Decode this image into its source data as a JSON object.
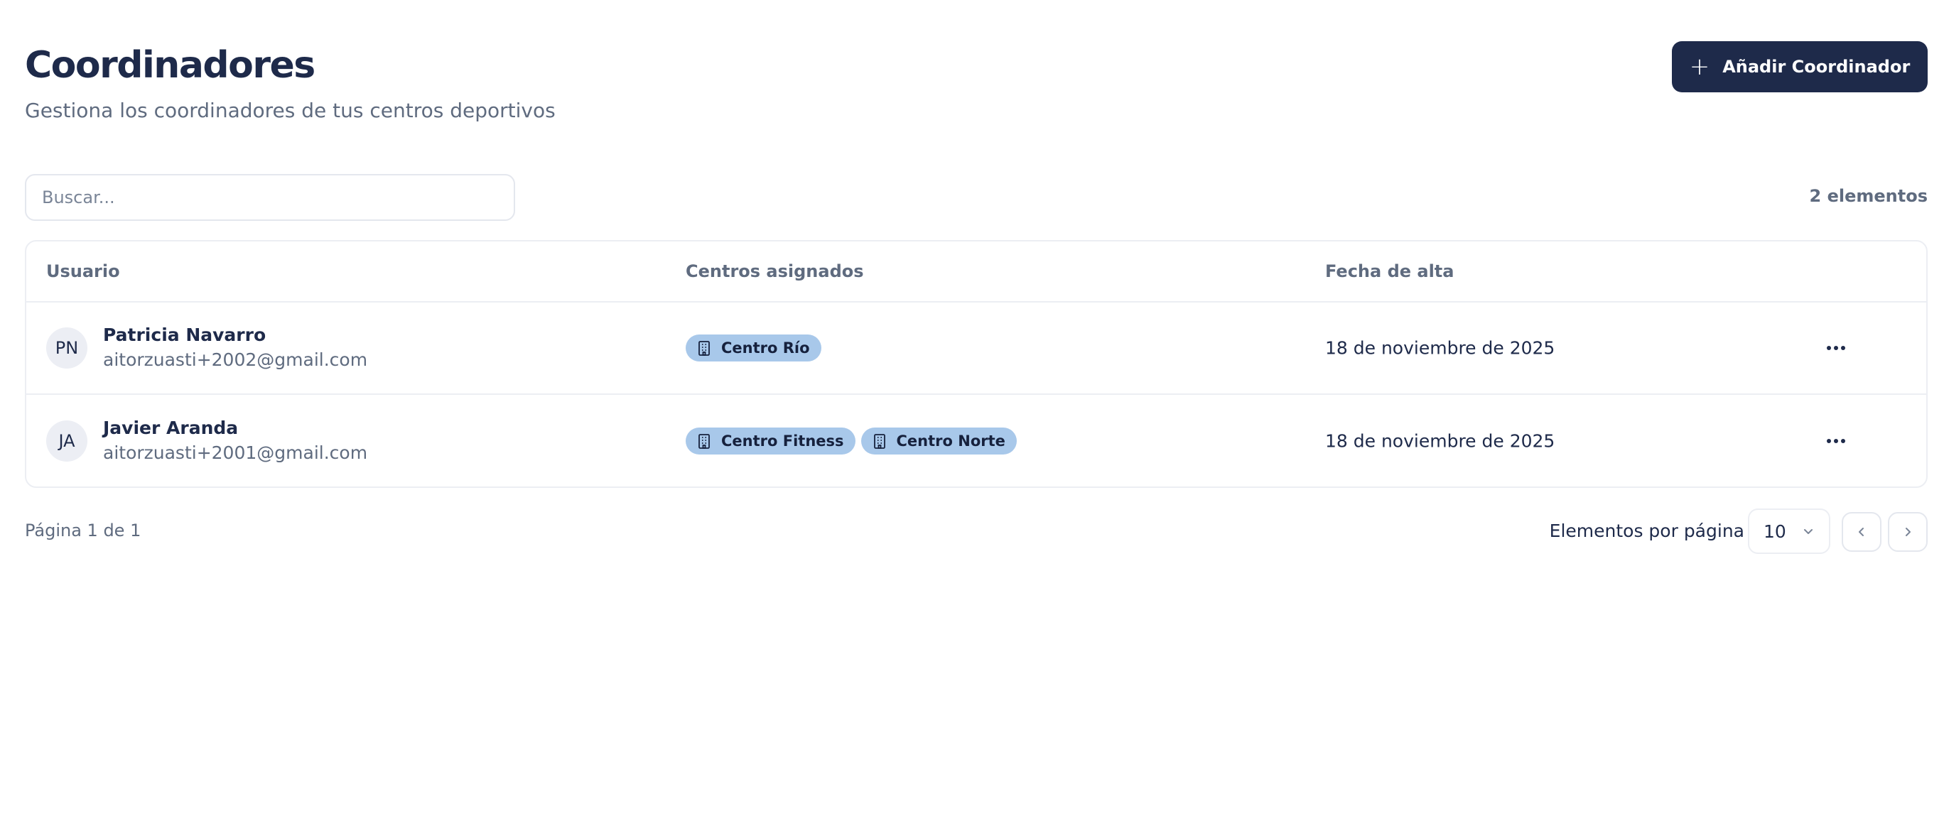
{
  "header": {
    "title": "Coordinadores",
    "subtitle": "Gestiona los coordinadores de tus centros deportivos",
    "add_button_label": "Añadir Coordinador"
  },
  "search": {
    "placeholder": "Buscar...",
    "value": ""
  },
  "count_label": "2 elementos",
  "table": {
    "columns": [
      "Usuario",
      "Centros asignados",
      "Fecha de alta"
    ],
    "rows": [
      {
        "initials": "PN",
        "name": "Patricia Navarro",
        "email": "aitorzuasti+2002@gmail.com",
        "centers": [
          "Centro Río"
        ],
        "date": "18 de noviembre de 2025"
      },
      {
        "initials": "JA",
        "name": "Javier Aranda",
        "email": "aitorzuasti+2001@gmail.com",
        "centers": [
          "Centro Fitness",
          "Centro Norte"
        ],
        "date": "18 de noviembre de 2025"
      }
    ]
  },
  "pagination": {
    "page_info": "Página 1 de 1",
    "per_page_label": "Elementos por página",
    "per_page_value": "10"
  },
  "colors": {
    "primary": "#1e2a4a",
    "chip": "#a8c8ea",
    "muted_text": "#5f6b7f",
    "border": "#eceef3"
  },
  "icons": {
    "add": "plus-icon",
    "center": "building-icon",
    "row_actions": "more-horizontal-icon",
    "select": "chevron-down-icon",
    "prev": "chevron-left-icon",
    "next": "chevron-right-icon"
  }
}
